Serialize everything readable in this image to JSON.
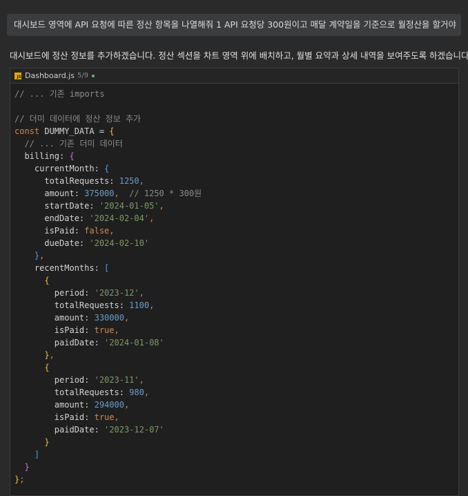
{
  "prompt": "대시보드 영역에 API 요청에 따른 정산 항목을 나열해줘 1 API 요청당 300원이고 매달 계약일을 기준으로 월정산을 할거야",
  "reply": "대시보드에 정산 정보를 추가하겠습니다. 정산 섹션을 차트 영역 위에 배치하고, 월별 요약과 상세 내역을 보여주도록 하겠습니다.",
  "codeblock": {
    "file_icon": "js-file-icon",
    "js_label": "JS",
    "filename": "Dashboard.js",
    "count": "5/9",
    "status_color": "#4ec96d",
    "lines": [
      [
        [
          "cm",
          "// ... 기존 imports"
        ]
      ],
      [],
      [
        [
          "cm",
          "// 더미 데이터에 정산 정보 추가"
        ]
      ],
      [
        [
          "kw",
          "const "
        ],
        [
          "id",
          "DUMMY_DATA = "
        ],
        [
          "b1",
          "{"
        ]
      ],
      [
        [
          "cm",
          "  // ... 기존 더미 데이터"
        ]
      ],
      [
        [
          "id",
          "  billing: "
        ],
        [
          "b2",
          "{"
        ]
      ],
      [
        [
          "id",
          "    currentMonth: "
        ],
        [
          "b3",
          "{"
        ]
      ],
      [
        [
          "id",
          "      totalRequests: "
        ],
        [
          "num",
          "1250"
        ],
        [
          "pu",
          ","
        ]
      ],
      [
        [
          "id",
          "      amount: "
        ],
        [
          "num",
          "375000"
        ],
        [
          "pu",
          ","
        ],
        [
          "cm",
          "  // 1250 * 300원"
        ]
      ],
      [
        [
          "id",
          "      startDate: "
        ],
        [
          "str",
          "'2024-01-05'"
        ],
        [
          "pu",
          ","
        ]
      ],
      [
        [
          "id",
          "      endDate: "
        ],
        [
          "str",
          "'2024-02-04'"
        ],
        [
          "pu",
          ","
        ]
      ],
      [
        [
          "id",
          "      isPaid: "
        ],
        [
          "bool",
          "false"
        ],
        [
          "pu",
          ","
        ]
      ],
      [
        [
          "id",
          "      dueDate: "
        ],
        [
          "str",
          "'2024-02-10'"
        ]
      ],
      [
        [
          "b3",
          "    }"
        ],
        [
          "pu",
          ","
        ]
      ],
      [
        [
          "id",
          "    recentMonths: "
        ],
        [
          "b3",
          "["
        ]
      ],
      [
        [
          "b1",
          "      {"
        ]
      ],
      [
        [
          "id",
          "        period: "
        ],
        [
          "str",
          "'2023-12'"
        ],
        [
          "pu",
          ","
        ]
      ],
      [
        [
          "id",
          "        totalRequests: "
        ],
        [
          "num",
          "1100"
        ],
        [
          "pu",
          ","
        ]
      ],
      [
        [
          "id",
          "        amount: "
        ],
        [
          "num",
          "330000"
        ],
        [
          "pu",
          ","
        ]
      ],
      [
        [
          "id",
          "        isPaid: "
        ],
        [
          "bool",
          "true"
        ],
        [
          "pu",
          ","
        ]
      ],
      [
        [
          "id",
          "        paidDate: "
        ],
        [
          "str",
          "'2024-01-08'"
        ]
      ],
      [
        [
          "b1",
          "      }"
        ],
        [
          "pu",
          ","
        ]
      ],
      [
        [
          "b1",
          "      {"
        ]
      ],
      [
        [
          "id",
          "        period: "
        ],
        [
          "str",
          "'2023-11'"
        ],
        [
          "pu",
          ","
        ]
      ],
      [
        [
          "id",
          "        totalRequests: "
        ],
        [
          "num",
          "980"
        ],
        [
          "pu",
          ","
        ]
      ],
      [
        [
          "id",
          "        amount: "
        ],
        [
          "num",
          "294000"
        ],
        [
          "pu",
          ","
        ]
      ],
      [
        [
          "id",
          "        isPaid: "
        ],
        [
          "bool",
          "true"
        ],
        [
          "pu",
          ","
        ]
      ],
      [
        [
          "id",
          "        paidDate: "
        ],
        [
          "str",
          "'2023-12-07'"
        ]
      ],
      [
        [
          "b1",
          "      }"
        ]
      ],
      [
        [
          "b3",
          "    ]"
        ]
      ],
      [
        [
          "b2",
          "  }"
        ]
      ],
      [
        [
          "b1",
          "}"
        ],
        [
          "pu",
          ";"
        ]
      ]
    ]
  }
}
